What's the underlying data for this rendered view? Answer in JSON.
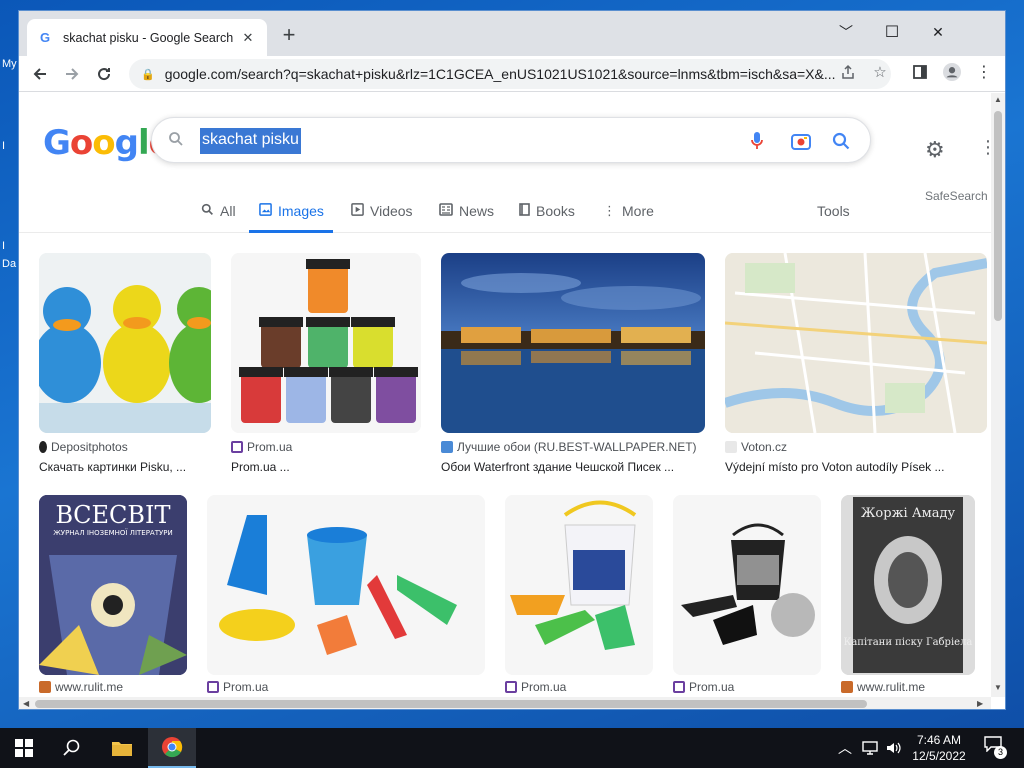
{
  "desktop": {
    "labels": [
      "My",
      "I",
      "I",
      "Da"
    ]
  },
  "browser": {
    "tab_title": "skachat pisku - Google Search",
    "tab_close": "✕",
    "new_tab": "+",
    "window_controls": {
      "minimize": "﹀",
      "maximize": "☐",
      "close": "✕"
    },
    "url": "google.com/search?q=skachat+pisku&rlz=1C1GCEA_enUS1021US1021&source=lnms&tbm=isch&sa=X&..."
  },
  "search": {
    "logo": "Google",
    "query": "skachat pisku",
    "tabs": [
      {
        "label": "All",
        "icon": "search-icon",
        "active": false
      },
      {
        "label": "Images",
        "icon": "image-icon",
        "active": true
      },
      {
        "label": "Videos",
        "icon": "play-icon",
        "active": false
      },
      {
        "label": "News",
        "icon": "news-icon",
        "active": false
      },
      {
        "label": "Books",
        "icon": "book-icon",
        "active": false
      },
      {
        "label": "More",
        "icon": "more-icon",
        "active": false
      }
    ],
    "tools": "Tools",
    "safesearch": "SafeSearch"
  },
  "results": [
    {
      "source": "Depositphotos",
      "caption": "Скачать картинки Pisku, ...",
      "thumb": "ducks"
    },
    {
      "source": "Prom.ua",
      "caption": "Prom.ua ...",
      "thumb": "jars"
    },
    {
      "source": "Лучшие обои (RU.BEST-WALLPAPER.NET)",
      "caption": "Обои Waterfront здание Чешской Писек ...",
      "thumb": "city"
    },
    {
      "source": "Voton.cz",
      "caption": "Výdejní místo pro Voton autodíly Písek ...",
      "thumb": "map"
    },
    {
      "source": "www.rulit.me",
      "caption": "",
      "thumb": "book1",
      "cover_title": "ВСЕСВІТ",
      "cover_sub": "ЖУРНАЛ ІНОЗЕМНОЇ ЛІТЕРАТУРИ"
    },
    {
      "source": "Prom.ua",
      "caption": "",
      "thumb": "sandset1"
    },
    {
      "source": "Prom.ua",
      "caption": "",
      "thumb": "sandset2"
    },
    {
      "source": "Prom.ua",
      "caption": "",
      "thumb": "sandset3"
    },
    {
      "source": "www.rulit.me",
      "caption": "",
      "thumb": "book2",
      "cover_title": "Жоржі Амаду",
      "cover_sub": "Капітани піску Габріела"
    }
  ],
  "taskbar": {
    "time": "7:46 AM",
    "date": "12/5/2022",
    "notification_count": "3"
  },
  "colors": {
    "accent": "#1a73e8",
    "taskbar": "#101218",
    "desktop": "#1a75d2"
  }
}
